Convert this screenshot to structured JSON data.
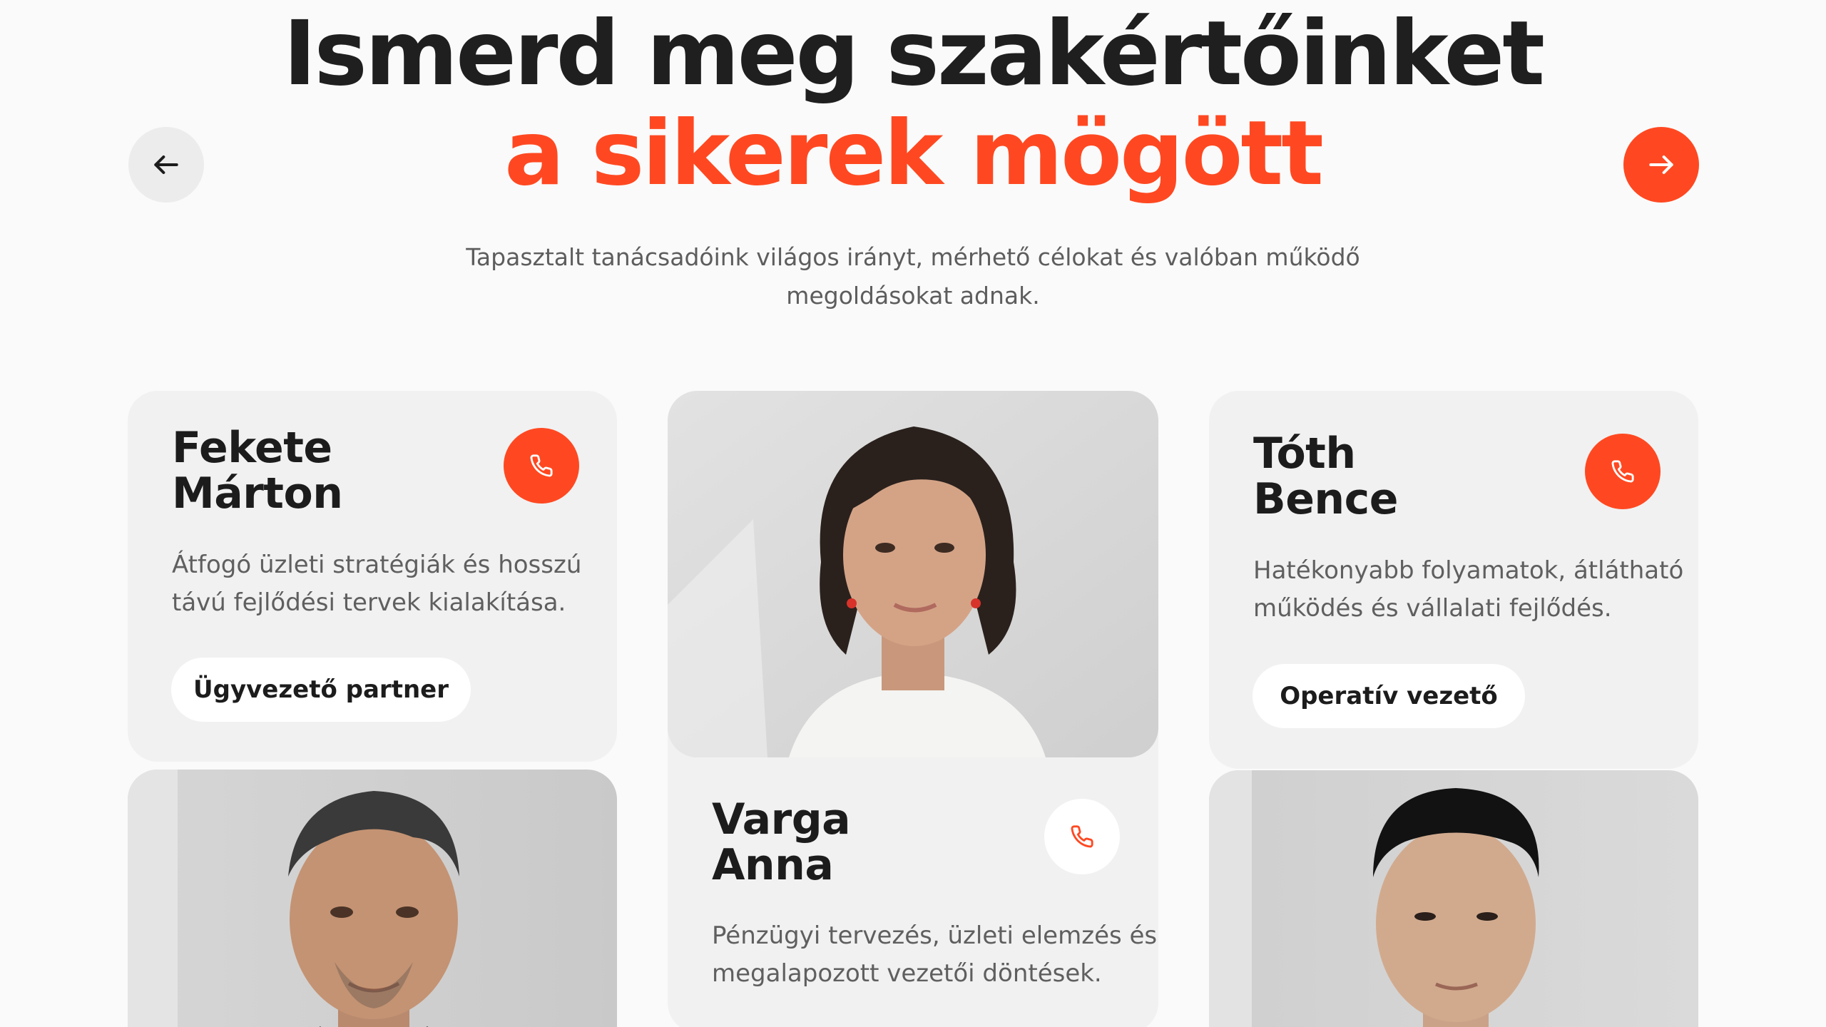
{
  "hero": {
    "title_line1": "Ismerd meg szakértőinket",
    "title_line2": "a sikerek mögött",
    "subtitle_line1": "Tapasztalt tanácsadóink világos irányt, mérhető célokat és valóban működő",
    "subtitle_line2": "megoldásokat adnak."
  },
  "nav": {
    "prev_icon": "arrow-left-icon",
    "next_icon": "arrow-right-icon"
  },
  "experts": [
    {
      "first": "Fekete",
      "last": "Márton",
      "desc_line1": "Átfogó üzleti stratégiák és hosszú",
      "desc_line2": "távú fejlődési tervek kialakítása.",
      "role": "Ügyvezető partner"
    },
    {
      "first": "Varga",
      "last": "Anna",
      "desc_line1": "Pénzügyi tervezés, üzleti elemzés és",
      "desc_line2": "megalapozott vezetői döntések."
    },
    {
      "first": "Tóth",
      "last": "Bence",
      "desc_line1": "Hatékonyabb folyamatok, átlátható",
      "desc_line2": "működés és vállalati fejlődés.",
      "role": "Operatív vezető"
    }
  ],
  "colors": {
    "accent": "#ff4821",
    "background": "#fafafa",
    "card": "#f1f1f1",
    "heading": "#1f1f1f"
  }
}
